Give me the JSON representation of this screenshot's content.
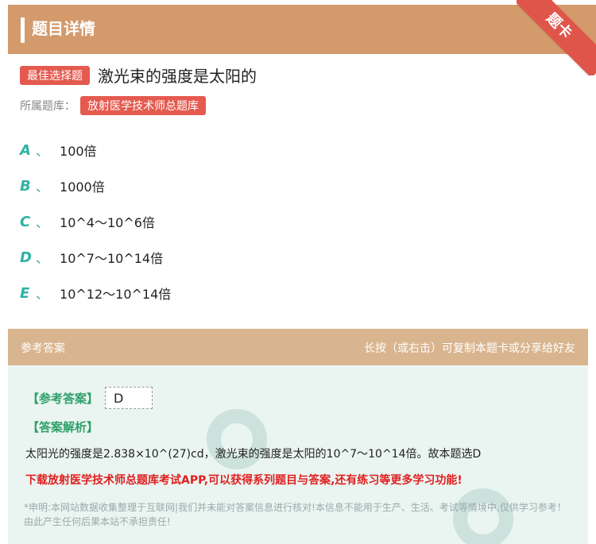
{
  "header": {
    "title": "题目详情",
    "corner_label": "题卡"
  },
  "question": {
    "type_badge": "最佳选择题",
    "text": "激光束的强度是太阳的",
    "bank_label": "所属题库：",
    "bank_name": "放射医学技术师总题库"
  },
  "options": [
    {
      "letter": "A",
      "sep": "、",
      "text": "100倍"
    },
    {
      "letter": "B",
      "sep": "、",
      "text": "1000倍"
    },
    {
      "letter": "C",
      "sep": "、",
      "text": "10^4～10^6倍"
    },
    {
      "letter": "D",
      "sep": "、",
      "text": "10^7～10^14倍"
    },
    {
      "letter": "E",
      "sep": "、",
      "text": "10^12～10^14倍"
    }
  ],
  "reference": {
    "title": "参考答案",
    "hint": "长按（或右击）可复制本题卡或分享给好友",
    "answer_label": "【参考答案】",
    "answer_value": "D",
    "analysis_label": "【答案解析】",
    "analysis_text": "太阳光的强度是2.838×10^(27)cd，激光束的强度是太阳的10^7～10^14倍。故本题选D",
    "promo": "下载放射医学技术师总题库考试APP,可以获得系列题目与答案,还有练习等更多学习功能!",
    "disclaimer": "*申明:本网站数据收集整理于互联网|我们并未能对答案信息进行核对!本信息不能用于生产、生活、考试等情境中,仅供学习参考！由此产生任何后果本站不承担责任!"
  },
  "colors": {
    "header_bg": "#d49a6c",
    "accent_red": "#e45a4f",
    "option_letter": "#2fb3a4",
    "answer_green": "#2fa06b"
  }
}
